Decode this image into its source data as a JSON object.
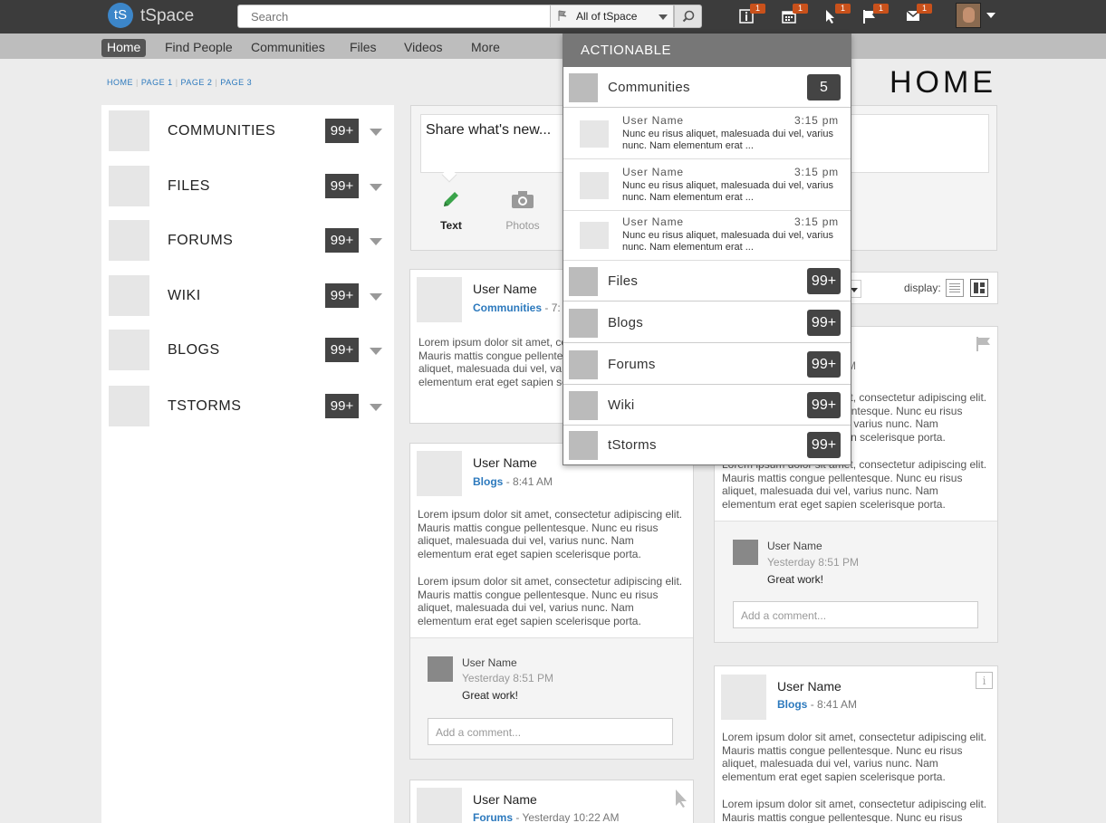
{
  "app": {
    "logo_mark": "tS",
    "name": "tSpace"
  },
  "search": {
    "placeholder": "Search",
    "scope": "All of tSpace"
  },
  "toolbar": {
    "icons": [
      {
        "name": "info-icon",
        "badge": "1"
      },
      {
        "name": "calendar-icon",
        "badge": "1"
      },
      {
        "name": "cursor-icon",
        "badge": "1"
      },
      {
        "name": "flag-icon",
        "badge": "1"
      },
      {
        "name": "mail-icon",
        "badge": "1"
      }
    ]
  },
  "nav": {
    "items": [
      "Home",
      "Find People",
      "Communities",
      "Files",
      "Videos",
      "More"
    ],
    "active": "Home"
  },
  "breadcrumbs": [
    "HOME",
    "PAGE 1",
    "PAGE 2",
    "PAGE 3"
  ],
  "page_title": "HOME",
  "sidebar": {
    "items": [
      {
        "label": "COMMUNITIES",
        "badge": "99+"
      },
      {
        "label": "FILES",
        "badge": "99+"
      },
      {
        "label": "FORUMS",
        "badge": "99+"
      },
      {
        "label": "WIKI",
        "badge": "99+"
      },
      {
        "label": "BLOGS",
        "badge": "99+"
      },
      {
        "label": "TSTORMS",
        "badge": "99+"
      }
    ]
  },
  "share": {
    "placeholder": "Share what's new...",
    "tabs": [
      "Text",
      "Photos"
    ]
  },
  "display": {
    "label": "display:"
  },
  "lorem": "Lorem ipsum dolor sit amet, consectetur adipiscing elit. Mauris mattis congue pellentesque. Nunc eu risus aliquet, malesuada dui vel, varius nunc. Nam elementum erat eget sapien scelerisque porta.",
  "posts": [
    {
      "user": "User Name",
      "source": "Communities",
      "time": "- 7:"
    },
    {
      "user": "User Name",
      "source": "Blogs",
      "time": "- 8:41 AM"
    },
    {
      "user": "User Name",
      "source": "Forums",
      "time": "- Yesterday 10:22 AM"
    },
    {
      "time_fragment": "AM"
    },
    {
      "user": "User Name",
      "source": "Blogs",
      "time": "- 8:41 AM"
    }
  ],
  "comments": [
    {
      "user": "User Name",
      "time": "Yesterday 8:51 PM",
      "text": "Great work!",
      "placeholder": "Add a comment..."
    },
    {
      "user": "User Name",
      "time": "Yesterday 8:51 PM",
      "text": "Great work!",
      "placeholder": "Add a comment..."
    }
  ],
  "actionable": {
    "title": "ACTIONABLE",
    "top": {
      "label": "Communities",
      "badge": "5"
    },
    "messages": [
      {
        "user": "User Name",
        "time": "3:15 pm",
        "text": "Nunc eu risus aliquet, malesuada dui vel, varius nunc. Nam elementum erat ..."
      },
      {
        "user": "User Name",
        "time": "3:15 pm",
        "text": "Nunc eu risus aliquet, malesuada dui vel, varius nunc. Nam elementum erat ..."
      },
      {
        "user": "User Name",
        "time": "3:15 pm",
        "text": "Nunc eu risus aliquet, malesuada dui vel, varius nunc. Nam elementum erat ..."
      }
    ],
    "rows": [
      {
        "label": "Files",
        "badge": "99+"
      },
      {
        "label": "Blogs",
        "badge": "99+"
      },
      {
        "label": "Forums",
        "badge": "99+"
      },
      {
        "label": "Wiki",
        "badge": "99+"
      },
      {
        "label": "tStorms",
        "badge": "99+"
      }
    ]
  },
  "colors": {
    "topbar": "#3c3c3c",
    "navbar": "#bdbdbd",
    "accent_link": "#2c79bd",
    "badge_orange": "#c9511b",
    "share_active_icon": "#3aa34a"
  }
}
